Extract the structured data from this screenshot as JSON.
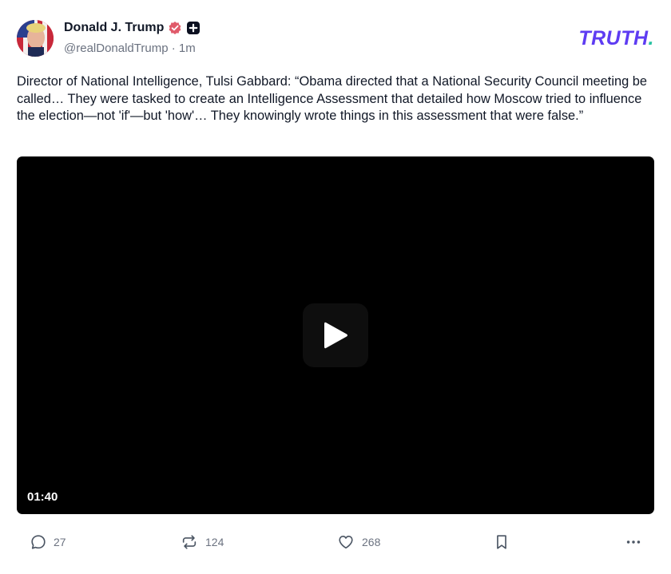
{
  "post": {
    "author_name": "Donald J. Trump",
    "handle": "@realDonaldTrump",
    "separator": "·",
    "time_ago": "1m",
    "body": "Director of National Intelligence, Tulsi Gabbard: “Obama directed that a National Security Council meeting be called… They were tasked to create an Intelligence Assessment that detailed how Moscow tried to influence the election—not 'if'—but 'how'… They knowingly wrote things in this assessment that were false.”"
  },
  "brand": {
    "logo_text": "TRUTH",
    "logo_dot": ".",
    "logo_color": "#5e3cf2",
    "dot_color": "#27c2a2"
  },
  "video": {
    "duration": "01:40",
    "icons": [
      "play-icon"
    ]
  },
  "actions": {
    "replies": "27",
    "retruths": "124",
    "likes": "268",
    "icons": [
      "reply-icon",
      "retruth-icon",
      "like-icon",
      "bookmark-icon",
      "more-icon"
    ]
  },
  "colors": {
    "verified_badge": "#e05a6a",
    "muted_text": "#6b7280",
    "icon": "#4b5563"
  }
}
